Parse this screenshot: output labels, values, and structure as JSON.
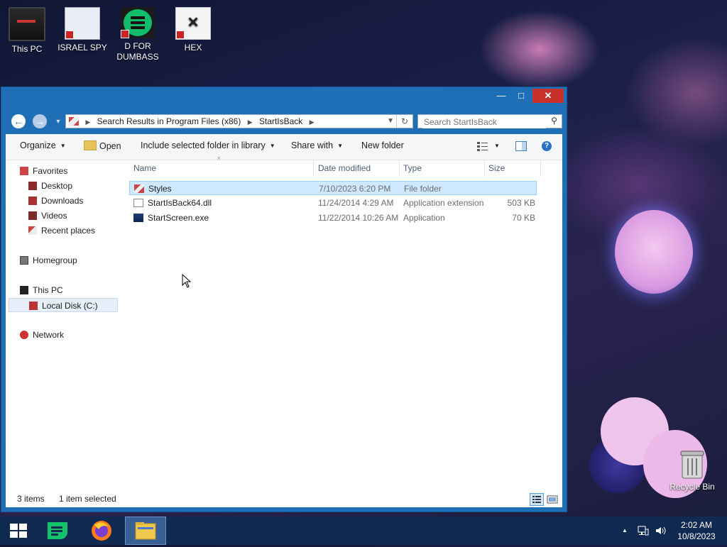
{
  "desktop": {
    "icons": [
      {
        "label": "This PC",
        "icon": "computer-icon"
      },
      {
        "label": "ISRAEL SPY",
        "icon": "network-computer-icon"
      },
      {
        "label": "D FOR DUMBASS",
        "icon": "green-chat-icon"
      },
      {
        "label": "HEX",
        "icon": "hex-editor-icon"
      }
    ],
    "recycle_bin": "Recycle Bin"
  },
  "window": {
    "controls": {
      "minimize": "—",
      "maximize": "□",
      "close": "✕"
    },
    "address": {
      "segments": [
        "Search Results in Program Files (x86)",
        "StartIsBack"
      ]
    },
    "search": {
      "placeholder": "Search StartIsBack"
    },
    "toolbar": {
      "organize": "Organize",
      "open": "Open",
      "include": "Include selected folder in library",
      "share": "Share with",
      "new_folder": "New folder"
    },
    "nav": {
      "favorites": "Favorites",
      "desktop": "Desktop",
      "downloads": "Downloads",
      "videos": "Videos",
      "recent": "Recent places",
      "homegroup": "Homegroup",
      "thispc": "This PC",
      "localdisk": "Local Disk (C:)",
      "network": "Network"
    },
    "columns": {
      "name": "Name",
      "date": "Date modified",
      "type": "Type",
      "size": "Size"
    },
    "files": [
      {
        "name": "Styles",
        "date": "7/10/2023 6:20 PM",
        "type": "File folder",
        "size": ""
      },
      {
        "name": "StartIsBack64.dll",
        "date": "11/24/2014 4:29 AM",
        "type": "Application extension",
        "size": "503 KB"
      },
      {
        "name": "StartScreen.exe",
        "date": "11/22/2014 10:26 AM",
        "type": "Application",
        "size": "70 KB"
      }
    ],
    "status": {
      "items": "3 items",
      "selected": "1 item selected"
    }
  },
  "taskbar": {
    "time": "2:02 AM",
    "date": "10/8/2023"
  },
  "colors": {
    "accent": "#1f6fb6",
    "taskbar": "#112a52",
    "selection": "#cde8ff"
  }
}
